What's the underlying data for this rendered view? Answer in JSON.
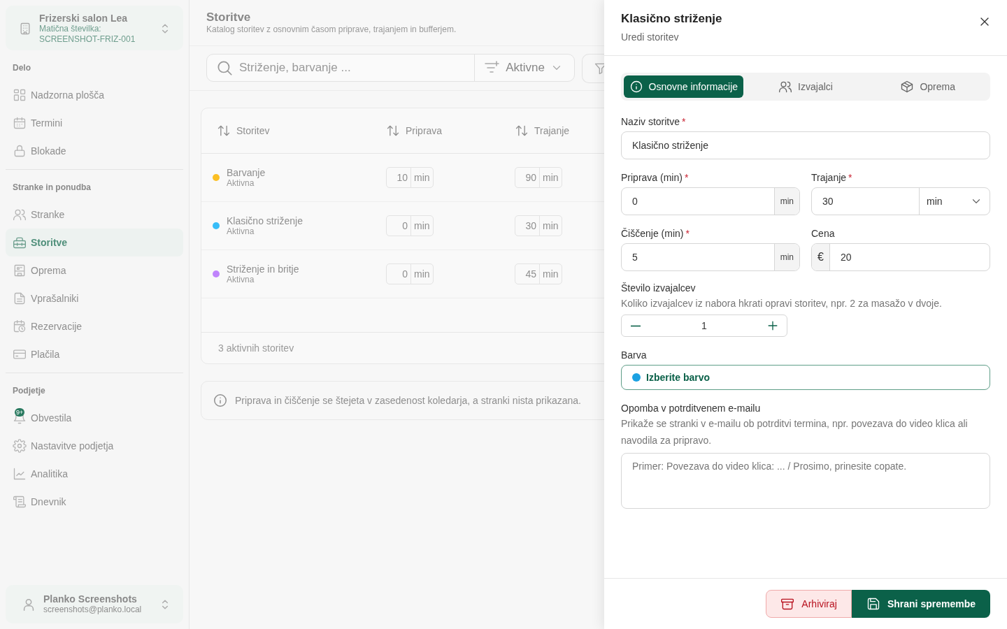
{
  "sidebar": {
    "org": {
      "name": "Frizerski salon Lea",
      "detail": "Matična številka: SCREENSHOT-FRIZ-001"
    },
    "sections": [
      {
        "title": "Delo",
        "items": [
          {
            "label": "Nadzorna plošča",
            "selected": false
          },
          {
            "label": "Termini",
            "selected": false
          },
          {
            "label": "Blokade",
            "selected": false
          }
        ]
      },
      {
        "title": "Stranke in ponudba",
        "items": [
          {
            "label": "Stranke",
            "selected": false
          },
          {
            "label": "Storitve",
            "selected": true
          },
          {
            "label": "Oprema",
            "selected": false
          },
          {
            "label": "Vprašalniki",
            "selected": false
          },
          {
            "label": "Rezervacije",
            "selected": false
          },
          {
            "label": "Plačila",
            "selected": false
          }
        ]
      },
      {
        "title": "Podjetje",
        "items": [
          {
            "label": "Obvestila",
            "selected": false,
            "badge": "9+"
          },
          {
            "label": "Nastavitve podjetja",
            "selected": false
          },
          {
            "label": "Analitika",
            "selected": false
          },
          {
            "label": "Dnevnik",
            "selected": false
          }
        ]
      }
    ],
    "user": {
      "name": "Planko Screenshots",
      "email": "screenshots@planko.local"
    }
  },
  "page": {
    "title": "Storitve",
    "subtitle": "Katalog storitev z osnovnim časom priprave, trajanjem in bufferjem."
  },
  "toolbar": {
    "search_placeholder": "Striženje, barvanje ...",
    "status_filter": "Aktivne"
  },
  "table": {
    "columns": [
      "Storitev",
      "Priprava",
      "Trajanje"
    ],
    "rows": [
      {
        "name": "Barvanje",
        "status": "Aktivna",
        "color": "#fbbf24",
        "prep": {
          "value": "10",
          "unit": "min"
        },
        "duration": {
          "value": "90",
          "unit": "min"
        }
      },
      {
        "name": "Klasično striženje",
        "status": "Aktivna",
        "color": "#38bdf8",
        "prep": {
          "value": "0",
          "unit": "min"
        },
        "duration": {
          "value": "30",
          "unit": "min"
        }
      },
      {
        "name": "Striženje in britje",
        "status": "Aktivna",
        "color": "#c084fc",
        "prep": {
          "value": "0",
          "unit": "min"
        },
        "duration": {
          "value": "45",
          "unit": "min"
        }
      }
    ],
    "footer": "3 aktivnih storitev"
  },
  "info_note": "Priprava in čiščenje se štejeta v zasedenost koledarja, a stranki nista prikazana.",
  "drawer": {
    "title": "Klasično striženje",
    "subtitle": "Uredi storitev",
    "tabs": [
      {
        "label": "Osnovne informacije",
        "selected": true
      },
      {
        "label": "Izvajalci",
        "selected": false
      },
      {
        "label": "Oprema",
        "selected": false
      }
    ],
    "name_field": {
      "label": "Naziv storitve",
      "required_mark": "*",
      "value": "Klasično striženje"
    },
    "prep_field": {
      "label": "Priprava (min)",
      "required_mark": "*",
      "value": "0",
      "unit": "min"
    },
    "duration_field": {
      "label": "Trajanje",
      "required_mark": "*",
      "value": "30",
      "unit": "min"
    },
    "cleanup_field": {
      "label": "Čiščenje (min)",
      "required_mark": "*",
      "value": "5",
      "unit": "min"
    },
    "price_field": {
      "label": "Cena",
      "currency": "€",
      "value": "20"
    },
    "staff_count": {
      "label": "Število izvajalcev",
      "hint": "Koliko izvajalcev iz nabora hkrati opravi storitev, npr. 2 za masažo v dvoje.",
      "value": "1"
    },
    "color_field": {
      "label": "Barva",
      "value": "Izberite barvo",
      "color": "#1ba1e2"
    },
    "email_note": {
      "label": "Opomba v potrditvenem e-mailu",
      "hint": "Prikaže se stranki v e-mailu ob potrditvi termina, npr. povezava do video klica ali navodila za pripravo.",
      "placeholder": "Primer: Povezava do video klica: ... / Prosimo, prinesite copate."
    },
    "buttons": [
      {
        "label": "Arhiviraj",
        "kind": "danger"
      },
      {
        "label": "Shrani spremembe",
        "kind": "primary"
      }
    ]
  }
}
